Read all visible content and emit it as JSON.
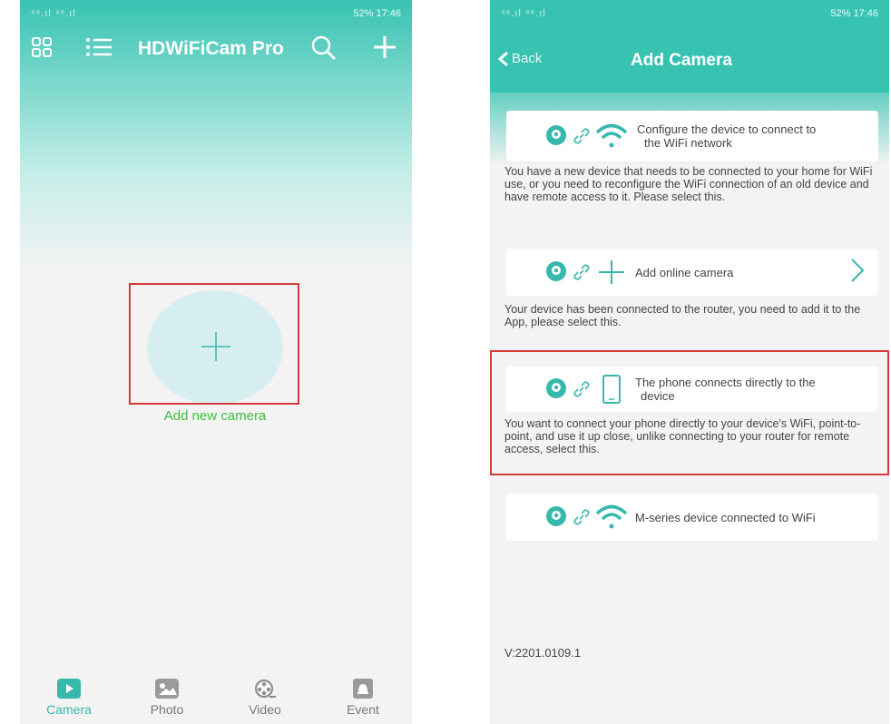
{
  "left_screen": {
    "status": {
      "signal": "⁴⁶.ıl ⁴⁶.ıl",
      "right": "52%",
      "time": "17:46"
    },
    "app_title": "HDWiFiCam Pro",
    "add_label": "Add new camera",
    "nav": [
      {
        "label": "Camera",
        "icon": "play-icon",
        "active": true
      },
      {
        "label": "Photo",
        "icon": "photo-icon",
        "active": false
      },
      {
        "label": "Video",
        "icon": "film-reel-icon",
        "active": false
      },
      {
        "label": "Event",
        "icon": "bell-icon",
        "active": false
      }
    ]
  },
  "right_screen": {
    "status": {
      "signal": "⁴⁶.ıl ⁴⁶.ıl",
      "right": "52%",
      "time": "17:46"
    },
    "back_label": "Back",
    "title": "Add Camera",
    "options": [
      {
        "title": "Configure the device to connect to the WiFi network",
        "title_line1": "Configure the device to connect to",
        "title_line2": "the WiFi network",
        "icon": "wifi-icon",
        "description": "You have a new device that needs to be connected to your home for WiFi use, or you need to reconfigure the WiFi connection of an old device and have remote access to it. Please select this."
      },
      {
        "title": "Add online camera",
        "icon": "plus-icon",
        "description": "Your device has been connected to the router, you need to add it to the App, please select this."
      },
      {
        "title_line1": "The phone connects directly to the",
        "title_line2": "device",
        "icon": "phone-icon",
        "description": "You want to connect your phone directly to your device's WiFi, point-to-point, and use it up close, unlike connecting to your router for remote access, select this."
      },
      {
        "title": "M-series device connected to WiFi",
        "icon": "wifi-icon"
      }
    ],
    "version": "V:2201.0109.1"
  },
  "colors": {
    "accent": "#38c2b2",
    "highlight": "#d43a3a",
    "add_label": "#3fbf3f"
  }
}
